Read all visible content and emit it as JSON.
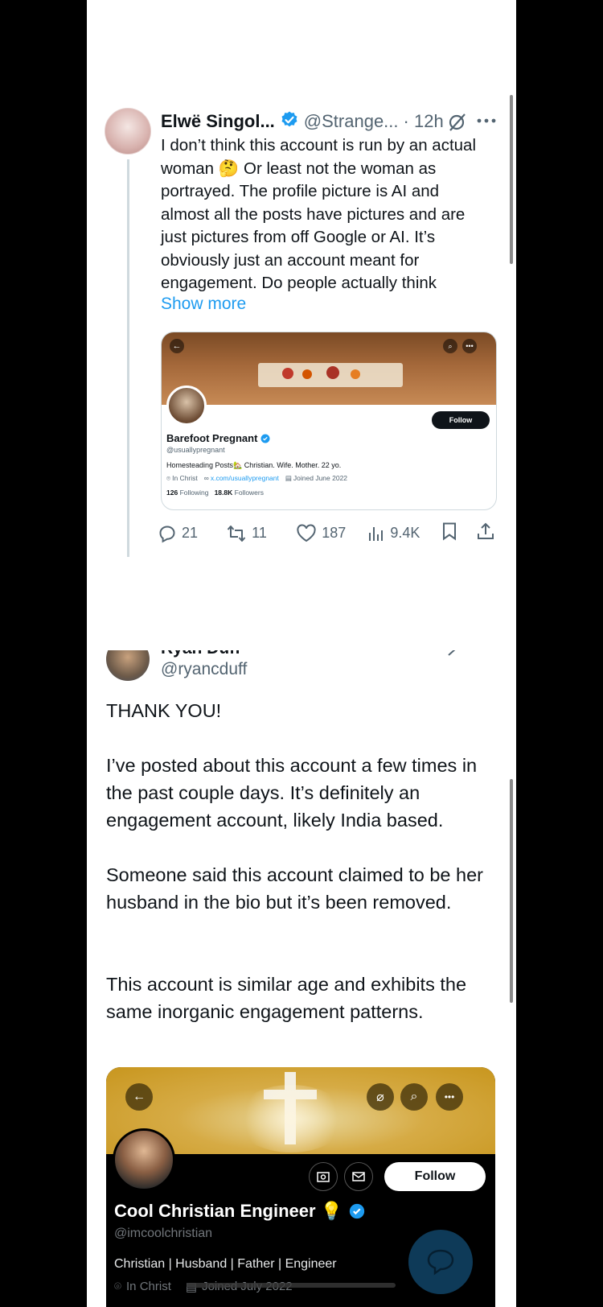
{
  "tweet1": {
    "display_name": "Elwë Singol...",
    "handle": "@Strange...",
    "time": "· 12h",
    "text": "I don’t think this account is run by an actual woman 🤔 Or least not the woman as portrayed. The profile picture is AI and almost all the posts have pictures and are just pictures from off Google or AI. It’s obviously just an account meant for engagement. Do people actually think",
    "show_more": "Show more",
    "embed": {
      "name": "Barefoot Pregnant",
      "handle": "@usuallypregnant",
      "bio": "Homesteading Posts🏡 Christian. Wife. Mother. 22 yo.",
      "location": "In Christ",
      "link": "x.com/usuallypregnant",
      "joined": "Joined June 2022",
      "following_count": "126",
      "following_label": "Following",
      "followers_count": "18.8K",
      "followers_label": "Followers",
      "follow_label": "Follow"
    },
    "actions": {
      "replies": "21",
      "reposts": "11",
      "likes": "187",
      "views": "9.4K"
    }
  },
  "tweet2": {
    "display_name": "Ryan Duff",
    "handle": "@ryancduff",
    "paragraphs": [
      "THANK YOU!",
      "I’ve posted about this account a few times in the past couple days. It’s definitely an engagement account, likely India based.",
      "Someone said this account claimed to be her husband in the bio but it’s been removed.",
      "This account is similar age and exhibits the same inorganic engagement patterns."
    ],
    "embed": {
      "name": "Cool Christian Engineer 💡",
      "handle": "@imcoolchristian",
      "bio": "Christian | Husband | Father | Engineer",
      "location": "In Christ",
      "joined": "Joined July 2022",
      "follow_label": "Follow"
    }
  },
  "colors": {
    "accent": "#1d9bf0",
    "text_primary": "#0f1419",
    "text_secondary": "#536471"
  }
}
